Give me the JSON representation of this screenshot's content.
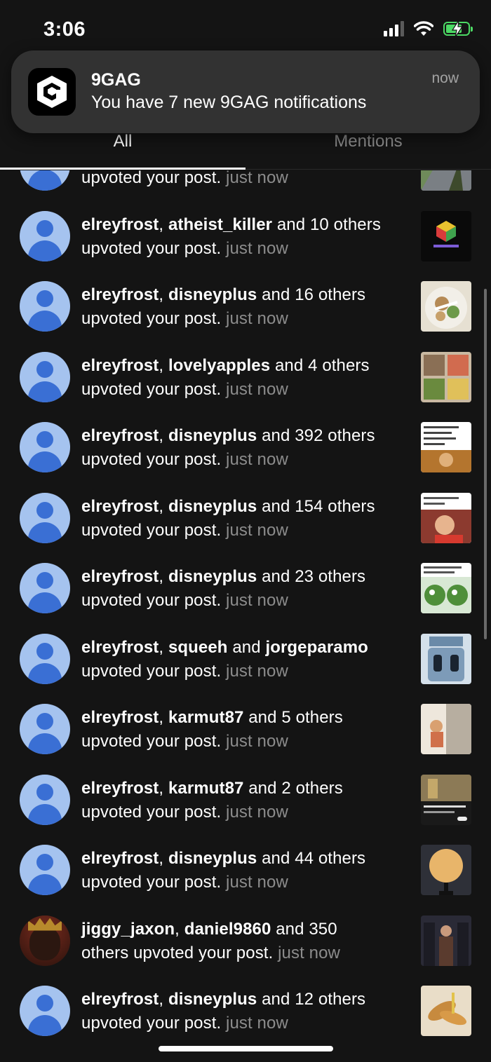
{
  "status_bar": {
    "time": "3:06"
  },
  "banner": {
    "app_name": "9GAG",
    "message": "You have 7 new 9GAG notifications",
    "time": "now"
  },
  "tabs": [
    {
      "label": "All",
      "active": true
    },
    {
      "label": "Mentions",
      "active": false
    }
  ],
  "colors": {
    "background": "#141414",
    "avatar_bg": "#a5c3ef",
    "avatar_fg": "#3a6fd4",
    "muted_text": "#8c8c8c",
    "battery": "#4cd964"
  },
  "notifications": [
    {
      "user1": "",
      "user2": "",
      "suffix": "",
      "line2": "upvoted your post.",
      "time": "just now"
    },
    {
      "user1": "elreyfrost",
      "user2": "atheist_killer",
      "suffix": " and 10 others",
      "line2": "upvoted your post.",
      "time": "just now"
    },
    {
      "user1": "elreyfrost",
      "user2": "disneyplus",
      "suffix": " and 16 others",
      "line2": "upvoted your post.",
      "time": "just now"
    },
    {
      "user1": "elreyfrost",
      "user2": "lovelyapples",
      "suffix": " and 4 others",
      "line2": "upvoted your post.",
      "time": "just now"
    },
    {
      "user1": "elreyfrost",
      "user2": "disneyplus",
      "suffix": " and 392 others",
      "line2": "upvoted your post.",
      "time": "just now"
    },
    {
      "user1": "elreyfrost",
      "user2": "disneyplus",
      "suffix": " and 154 others",
      "line2": "upvoted your post.",
      "time": "just now"
    },
    {
      "user1": "elreyfrost",
      "user2": "disneyplus",
      "suffix": " and 23 others",
      "line2": "upvoted your post.",
      "time": "just now"
    },
    {
      "user1": "elreyfrost",
      "user2": "squeeh",
      "mid": " and ",
      "user3": "jorgeparamo",
      "line2": "upvoted your post.",
      "time": "just now"
    },
    {
      "user1": "elreyfrost",
      "user2": "karmut87",
      "suffix": " and 5 others",
      "line2": "upvoted your post.",
      "time": "just now"
    },
    {
      "user1": "elreyfrost",
      "user2": "karmut87",
      "suffix": " and 2 others",
      "line2": "upvoted your post.",
      "time": "just now"
    },
    {
      "user1": "elreyfrost",
      "user2": "disneyplus",
      "suffix": " and 44 others",
      "line2": "upvoted your post.",
      "time": "just now"
    },
    {
      "user1": "jiggy_jaxon",
      "user2": "daniel9860",
      "suffix": " and 350",
      "line2": "others upvoted your post.",
      "time": "just now"
    },
    {
      "user1": "elreyfrost",
      "user2": "disneyplus",
      "suffix": " and 12 others",
      "line2": "upvoted your post.",
      "time": "just now"
    }
  ]
}
